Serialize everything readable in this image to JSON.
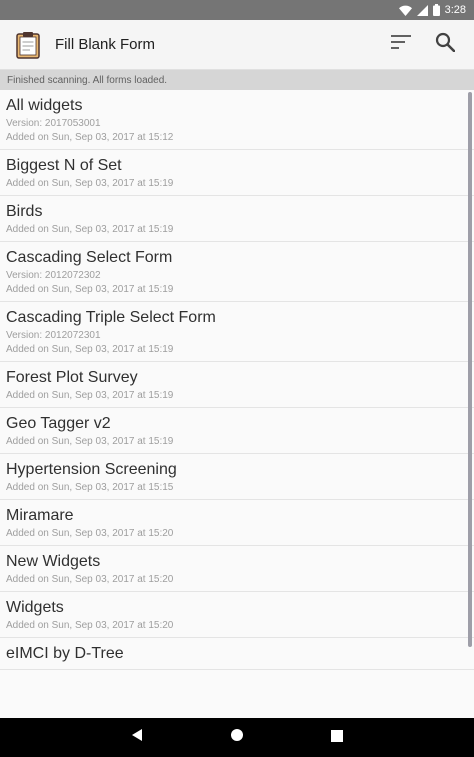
{
  "status_bar": {
    "time": "3:28"
  },
  "app_bar": {
    "title": "Fill Blank Form"
  },
  "status_strip": {
    "message": "Finished scanning. All forms loaded."
  },
  "forms": [
    {
      "name": "All widgets",
      "version": "Version: 2017053001",
      "added": "Added on Sun, Sep 03, 2017 at 15:12"
    },
    {
      "name": "Biggest N of Set",
      "version": "",
      "added": "Added on Sun, Sep 03, 2017 at 15:19"
    },
    {
      "name": "Birds",
      "version": "",
      "added": "Added on Sun, Sep 03, 2017 at 15:19"
    },
    {
      "name": "Cascading Select Form",
      "version": "Version: 2012072302",
      "added": "Added on Sun, Sep 03, 2017 at 15:19"
    },
    {
      "name": "Cascading Triple Select Form",
      "version": "Version: 2012072301",
      "added": "Added on Sun, Sep 03, 2017 at 15:19"
    },
    {
      "name": "Forest Plot Survey",
      "version": "",
      "added": "Added on Sun, Sep 03, 2017 at 15:19"
    },
    {
      "name": "Geo Tagger v2",
      "version": "",
      "added": "Added on Sun, Sep 03, 2017 at 15:19"
    },
    {
      "name": "Hypertension Screening",
      "version": "",
      "added": "Added on Sun, Sep 03, 2017 at 15:15"
    },
    {
      "name": "Miramare",
      "version": "",
      "added": "Added on Sun, Sep 03, 2017 at 15:20"
    },
    {
      "name": "New Widgets",
      "version": "",
      "added": "Added on Sun, Sep 03, 2017 at 15:20"
    },
    {
      "name": "Widgets",
      "version": "",
      "added": "Added on Sun, Sep 03, 2017 at 15:20"
    },
    {
      "name": "eIMCI by D-Tree",
      "version": "",
      "added": ""
    }
  ],
  "icons": {
    "app": "clipboard-icon",
    "sort": "sort-icon",
    "search": "search-icon",
    "wifi": "wifi-icon",
    "signal": "signal-icon",
    "battery": "battery-icon",
    "back": "back-icon",
    "home": "home-icon",
    "recents": "recents-icon"
  },
  "colors": {
    "status_bar": "#757575",
    "app_bar": "#f5f5f5",
    "status_strip": "#d6d6d6",
    "nav_bar": "#000000"
  }
}
